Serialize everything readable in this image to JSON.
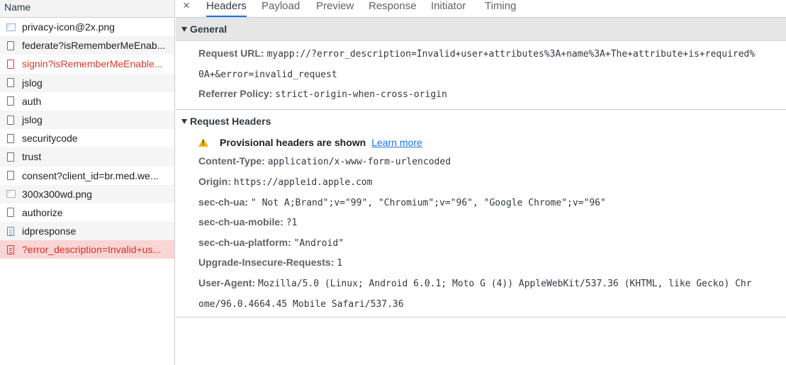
{
  "list": {
    "header": "Name",
    "items": [
      {
        "name": "privacy-icon@2x.png",
        "icon": "image-file-icon",
        "state": "normal"
      },
      {
        "name": "federate?isRememberMeEnab...",
        "icon": "document-icon",
        "state": "normal"
      },
      {
        "name": "signin?isRememberMeEnable...",
        "icon": "document-icon",
        "state": "error"
      },
      {
        "name": "jslog",
        "icon": "document-icon",
        "state": "normal"
      },
      {
        "name": "auth",
        "icon": "document-icon",
        "state": "normal"
      },
      {
        "name": "jslog",
        "icon": "document-icon",
        "state": "normal"
      },
      {
        "name": "securitycode",
        "icon": "document-icon",
        "state": "normal"
      },
      {
        "name": "trust",
        "icon": "document-icon",
        "state": "normal"
      },
      {
        "name": "consent?client_id=br.med.we...",
        "icon": "document-icon",
        "state": "normal"
      },
      {
        "name": "300x300wd.png",
        "icon": "image-file-icon",
        "state": "normal"
      },
      {
        "name": "authorize",
        "icon": "document-icon",
        "state": "normal"
      },
      {
        "name": "idpresponse",
        "icon": "html-document-icon",
        "state": "normal"
      },
      {
        "name": "?error_description=Invalid+us...",
        "icon": "html-document-icon",
        "state": "selected-error"
      }
    ]
  },
  "tabs": {
    "close": "×",
    "headers": "Headers",
    "payload": "Payload",
    "preview": "Preview",
    "response": "Response",
    "initiator": "Initiator",
    "timing": "Timing",
    "active": "Headers"
  },
  "general": {
    "title": "General",
    "request_url_label": "Request URL:",
    "request_url_line1": "myapp://?error_description=Invalid+user+attributes%3A+name%3A+The+attribute+is+required%",
    "request_url_line2": "0A+&error=invalid_request",
    "referrer_label": "Referrer Policy:",
    "referrer_value": "strict-origin-when-cross-origin"
  },
  "request_headers": {
    "title": "Request Headers",
    "provisional_text": "Provisional headers are shown",
    "learn_more": "Learn more",
    "content_type_label": "Content-Type:",
    "content_type_value": "application/x-www-form-urlencoded",
    "origin_label": "Origin:",
    "origin_value": "https://appleid.apple.com",
    "sec_ch_ua_label": "sec-ch-ua:",
    "sec_ch_ua_value": "\" Not A;Brand\";v=\"99\", \"Chromium\";v=\"96\", \"Google Chrome\";v=\"96\"",
    "sec_ch_ua_mobile_label": "sec-ch-ua-mobile:",
    "sec_ch_ua_mobile_value": "?1",
    "sec_ch_ua_platform_label": "sec-ch-ua-platform:",
    "sec_ch_ua_platform_value": "\"Android\"",
    "upgrade_label": "Upgrade-Insecure-Requests:",
    "upgrade_value": "1",
    "user_agent_label": "User-Agent:",
    "user_agent_line1": "Mozilla/5.0 (Linux; Android 6.0.1; Moto G (4)) AppleWebKit/537.36 (KHTML, like Gecko) Chr",
    "user_agent_line2": "ome/96.0.4664.45 Mobile Safari/537.36"
  },
  "colors": {
    "accent": "#1a73e8",
    "error": "#e0392b",
    "selected_row": "#fad5d5",
    "warning": "#f2b600"
  }
}
